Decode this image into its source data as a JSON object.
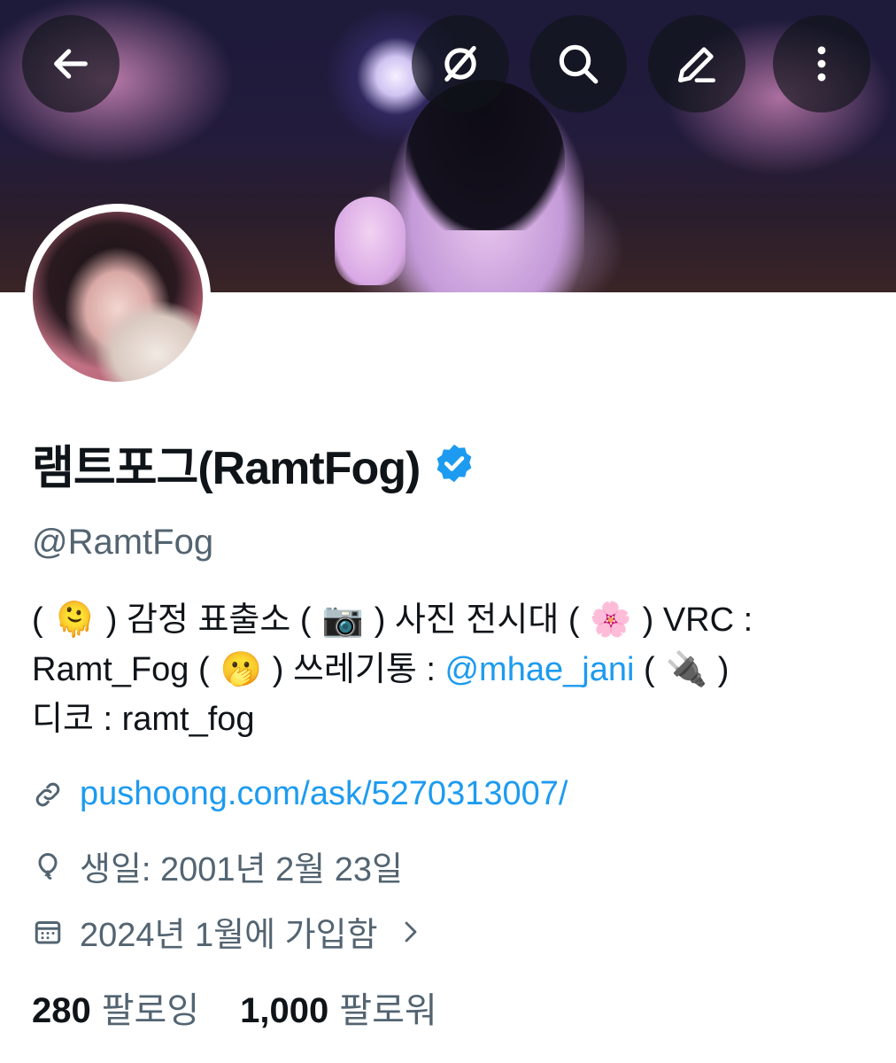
{
  "header": {
    "buttons": [
      {
        "name": "back-button",
        "icon": "arrow-left-icon"
      },
      {
        "name": "translate-button",
        "icon": "strikethrough-circle-icon"
      },
      {
        "name": "search-button",
        "icon": "search-icon"
      },
      {
        "name": "edit-button",
        "icon": "pencil-icon"
      },
      {
        "name": "more-button",
        "icon": "more-vertical-icon"
      }
    ]
  },
  "profile": {
    "display_name": "램트포그(RamtFog)",
    "verified": true,
    "handle": "@RamtFog",
    "bio": {
      "p1": "(",
      "e1": "🫠",
      "p2": ") 감정 표출소 (",
      "e2": "📷",
      "p3": ") 사진 전시대 (",
      "e3": "🌸",
      "p4": ") VRC : Ramt_Fog (",
      "e4": "🫢",
      "p5": ") 쓰레기통 :",
      "mention": "@mhae_jani",
      "p6": "(",
      "e5": "🔌",
      "p7": ")",
      "p8": "디코 : ramt_fog"
    },
    "website": "pushoong.com/ask/5270313007/",
    "birthday": "생일: 2001년 2월 23일",
    "joined": "2024년 1월에 가입함"
  },
  "stats": {
    "following_count": "280",
    "following_label": "팔로잉",
    "followers_count": "1,000",
    "followers_label": "팔로워"
  },
  "colors": {
    "accent": "#1d9bf0",
    "secondary_text": "#536471",
    "primary_text": "#0f1419"
  }
}
